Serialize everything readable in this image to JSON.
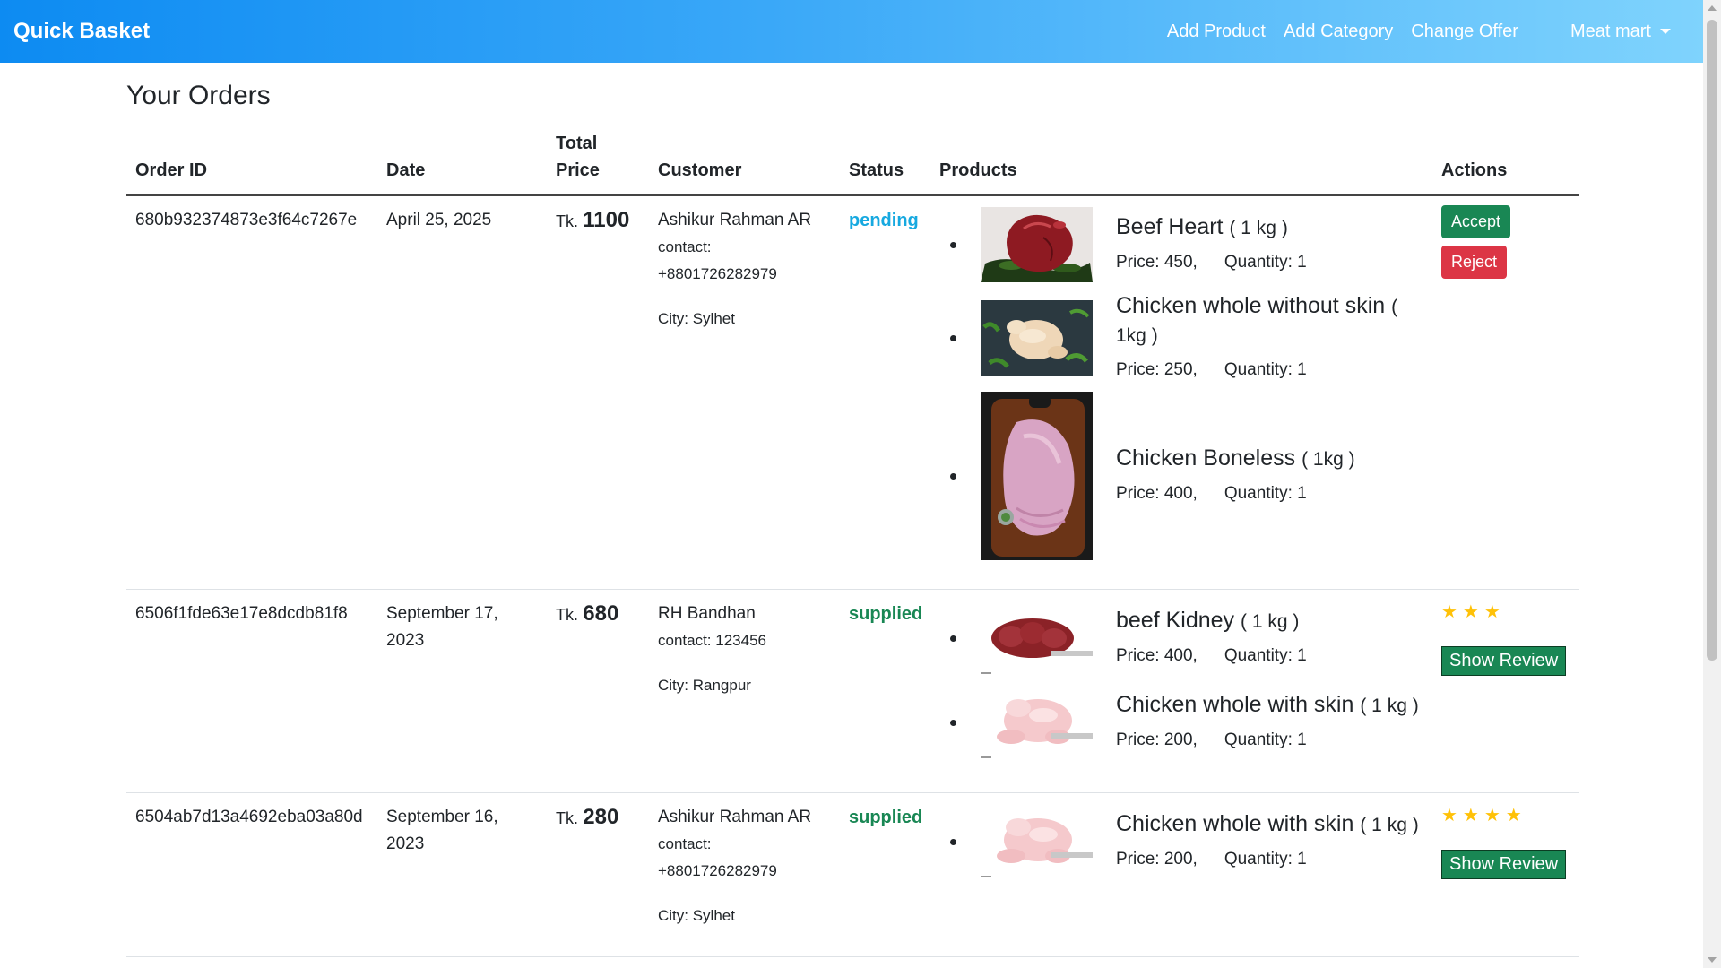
{
  "navbar": {
    "brand": "Quick Basket",
    "links": [
      "Add Product",
      "Add Category",
      "Change Offer"
    ],
    "store_label": "Meat mart"
  },
  "page": {
    "title": "Your Orders"
  },
  "table": {
    "headers": {
      "order_id": "Order ID",
      "date": "Date",
      "total_price_1": "Total",
      "total_price_2": "Price",
      "customer": "Customer",
      "status": "Status",
      "products": "Products",
      "actions": "Actions"
    },
    "currency": "Tk.",
    "orders": [
      {
        "id": "680b932374873e3f64c7267e",
        "date": "April 25, 2025",
        "total": "1100",
        "customer_name": "Ashikur Rahman AR",
        "contact": "contact: +8801726282979",
        "city": "City: Sylhet",
        "status": "pending",
        "products": [
          {
            "name": "Beef Heart",
            "unit": "( 1 kg )",
            "price": "Price: 450,",
            "quantity": "Quantity: 1",
            "image": "beef-heart-photo"
          },
          {
            "name": "Chicken whole without skin",
            "unit": "( 1kg )",
            "price": "Price: 250,",
            "quantity": "Quantity: 1",
            "image": "chicken-whole-without-skin-photo"
          },
          {
            "name": "Chicken Boneless",
            "unit": "( 1kg )",
            "price": "Price: 400,",
            "quantity": "Quantity: 1",
            "image": "chicken-boneless-photo"
          }
        ],
        "actions": {
          "accept": "Accept",
          "reject": "Reject"
        }
      },
      {
        "id": "6506f1fde63e17e8dcdb81f8",
        "date": "September 17, 2023",
        "total": "680",
        "customer_name": "RH Bandhan",
        "contact": "contact: 123456",
        "city": "City: Rangpur",
        "status": "supplied",
        "products": [
          {
            "name": "beef Kidney",
            "unit": "( 1 kg )",
            "price": "Price: 400,",
            "quantity": "Quantity: 1",
            "image": "beef-kidney-photo"
          },
          {
            "name": "Chicken whole with skin",
            "unit": "( 1 kg )",
            "price": "Price: 200,",
            "quantity": "Quantity: 1",
            "image": "chicken-whole-with-skin-photo"
          }
        ],
        "rating": 3,
        "stars": "★★★",
        "actions": {
          "review": "Show Review"
        }
      },
      {
        "id": "6504ab7d13a4692eba03a80d",
        "date": "September 16, 2023",
        "total": "280",
        "customer_name": "Ashikur Rahman AR",
        "contact": "contact: +8801726282979",
        "city": "City: Sylhet",
        "status": "supplied",
        "products": [
          {
            "name": "Chicken whole with skin",
            "unit": "( 1 kg )",
            "price": "Price: 200,",
            "quantity": "Quantity: 1",
            "image": "chicken-whole-with-skin-photo"
          }
        ],
        "rating": 4,
        "stars": "★★★★",
        "actions": {
          "review": "Show Review"
        }
      }
    ]
  },
  "colors": {
    "navbar_start": "#0d8bf2",
    "navbar_end": "#7fd3fd",
    "pending": "#17a9e0",
    "supplied": "#198754",
    "accept": "#198754",
    "reject": "#dc3545",
    "star": "#ffc107"
  }
}
